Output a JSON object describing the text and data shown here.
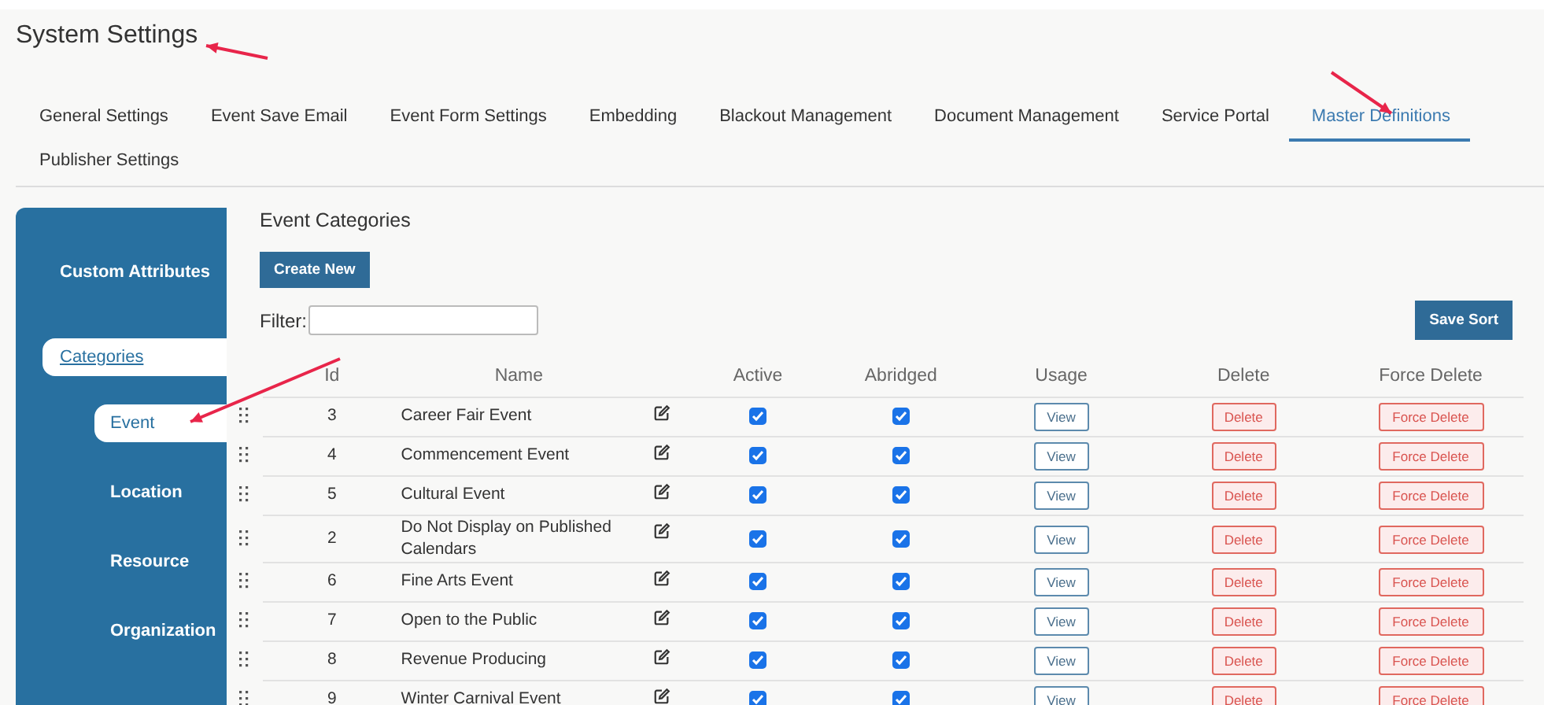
{
  "page": {
    "title": "System Settings"
  },
  "tabs": [
    {
      "label": "General Settings",
      "selected": false
    },
    {
      "label": "Event Save Email",
      "selected": false
    },
    {
      "label": "Event Form Settings",
      "selected": false
    },
    {
      "label": "Embedding",
      "selected": false
    },
    {
      "label": "Blackout Management",
      "selected": false
    },
    {
      "label": "Document Management",
      "selected": false
    },
    {
      "label": "Service Portal",
      "selected": false
    },
    {
      "label": "Master Definitions",
      "selected": true
    },
    {
      "label": "Publisher Settings",
      "selected": false
    }
  ],
  "sidebar": {
    "items": [
      {
        "label": "Custom Attributes",
        "selected": false
      },
      {
        "label": "Categories",
        "selected": true,
        "children": [
          {
            "label": "Event",
            "selected": true
          },
          {
            "label": "Location",
            "selected": false
          },
          {
            "label": "Resource",
            "selected": false
          },
          {
            "label": "Organization",
            "selected": false
          }
        ]
      }
    ]
  },
  "content": {
    "title": "Event Categories",
    "create_button": "Create New",
    "filter_label": "Filter:",
    "save_sort_button": "Save Sort",
    "columns": [
      "Id",
      "Name",
      "Active",
      "Abridged",
      "Usage",
      "Delete",
      "Force Delete"
    ],
    "rows": [
      {
        "id": "3",
        "name": "Career Fair Event",
        "active": true,
        "abridged": true,
        "usage": "View",
        "delete": "Delete",
        "force_delete": "Force Delete"
      },
      {
        "id": "4",
        "name": "Commencement Event",
        "active": true,
        "abridged": true,
        "usage": "View",
        "delete": "Delete",
        "force_delete": "Force Delete"
      },
      {
        "id": "5",
        "name": "Cultural Event",
        "active": true,
        "abridged": true,
        "usage": "View",
        "delete": "Delete",
        "force_delete": "Force Delete"
      },
      {
        "id": "2",
        "name": "Do Not Display on Published Calendars",
        "active": true,
        "abridged": true,
        "usage": "View",
        "delete": "Delete",
        "force_delete": "Force Delete"
      },
      {
        "id": "6",
        "name": "Fine Arts Event",
        "active": true,
        "abridged": true,
        "usage": "View",
        "delete": "Delete",
        "force_delete": "Force Delete"
      },
      {
        "id": "7",
        "name": "Open to the Public",
        "active": true,
        "abridged": true,
        "usage": "View",
        "delete": "Delete",
        "force_delete": "Force Delete"
      },
      {
        "id": "8",
        "name": "Revenue Producing",
        "active": true,
        "abridged": true,
        "usage": "View",
        "delete": "Delete",
        "force_delete": "Force Delete"
      },
      {
        "id": "9",
        "name": "Winter Carnival Event",
        "active": true,
        "abridged": true,
        "usage": "View",
        "delete": "Delete",
        "force_delete": "Force Delete"
      }
    ]
  }
}
